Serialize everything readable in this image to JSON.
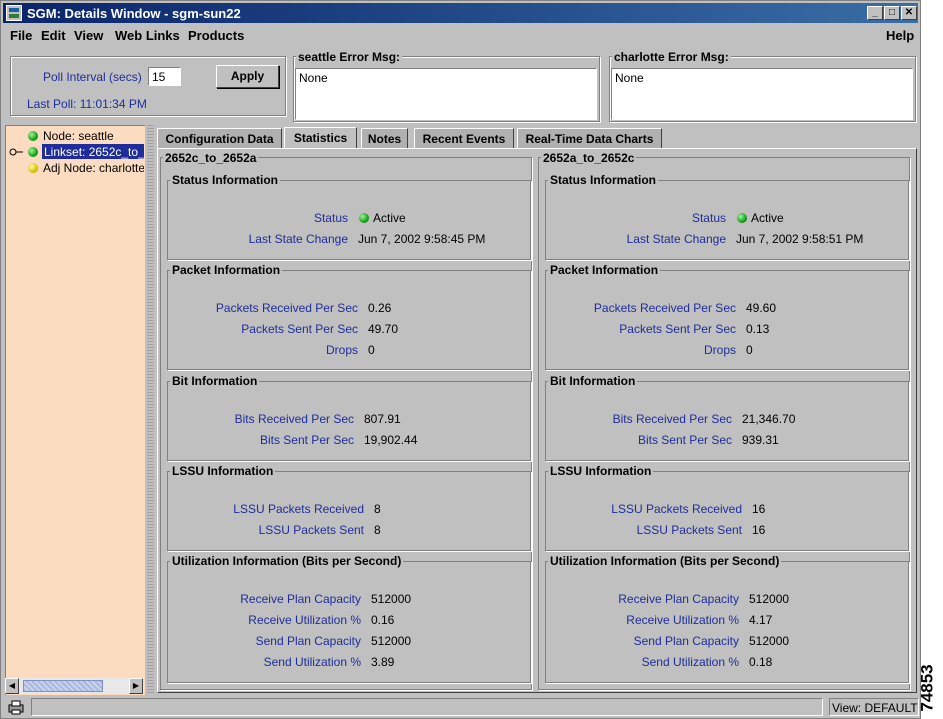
{
  "window": {
    "title": "SGM: Details Window - sgm-sun22",
    "controls": [
      "_",
      "□",
      "✕"
    ]
  },
  "menubar": {
    "file": "File",
    "edit": "Edit",
    "view": "View",
    "weblinks": "Web Links",
    "products": "Products",
    "help": "Help"
  },
  "poll": {
    "label": "Poll Interval (secs)",
    "value": "15",
    "apply": "Apply",
    "last_poll": "Last Poll:  11:01:34 PM"
  },
  "errors": [
    {
      "title": "seattle  Error Msg:",
      "text": "None"
    },
    {
      "title": "charlotte  Error Msg:",
      "text": "None"
    }
  ],
  "tree": {
    "items": [
      {
        "label": "Node: seattle",
        "status": "green",
        "icon": "status-dot-icon"
      },
      {
        "label": "Linkset: 2652c_to_",
        "status": "green",
        "icon": "status-dot-icon",
        "selected": true
      },
      {
        "label": "Adj Node: charlotte",
        "status": "yellow",
        "icon": "status-dot-icon"
      }
    ]
  },
  "tabs": [
    "Configuration Data",
    "Statistics",
    "Notes",
    "Recent Events",
    "Real-Time Data Charts"
  ],
  "active_tab": "Statistics",
  "labels": {
    "status_section": "Status Information",
    "status": "Status",
    "last_state_change": "Last State Change",
    "packet_section": "Packet Information",
    "pkts_rcv": "Packets Received Per Sec",
    "pkts_sent": "Packets Sent Per Sec",
    "drops": "Drops",
    "bit_section": "Bit Information",
    "bits_rcv": "Bits Received Per Sec",
    "bits_sent": "Bits Sent Per Sec",
    "lssu_section": "LSSU Information",
    "lssu_rcv": "LSSU Packets Received",
    "lssu_sent": "LSSU Packets Sent",
    "util_section": "Utilization Information (Bits per Second)",
    "rcv_cap": "Receive Plan Capacity",
    "rcv_util": "Receive Utilization %",
    "send_cap": "Send Plan Capacity",
    "send_util": "Send Utilization %"
  },
  "links": [
    {
      "name": "2652c_to_2652a",
      "status": "Active",
      "last_state_change": "Jun 7, 2002 9:58:45 PM",
      "pkts_rcv": "0.26",
      "pkts_sent": "49.70",
      "drops": "0",
      "bits_rcv": "807.91",
      "bits_sent": "19,902.44",
      "lssu_rcv": "8",
      "lssu_sent": "8",
      "rcv_cap": "512000",
      "rcv_util": "0.16",
      "send_cap": "512000",
      "send_util": "3.89"
    },
    {
      "name": "2652a_to_2652c",
      "status": "Active",
      "last_state_change": "Jun 7, 2002 9:58:51 PM",
      "pkts_rcv": "49.60",
      "pkts_sent": "0.13",
      "drops": "0",
      "bits_rcv": "21,346.70",
      "bits_sent": "939.31",
      "lssu_rcv": "16",
      "lssu_sent": "16",
      "rcv_cap": "512000",
      "rcv_util": "4.17",
      "send_cap": "512000",
      "send_util": "0.18"
    }
  ],
  "statusbar": {
    "view": "View: DEFAULT"
  },
  "figure_id": "74853"
}
